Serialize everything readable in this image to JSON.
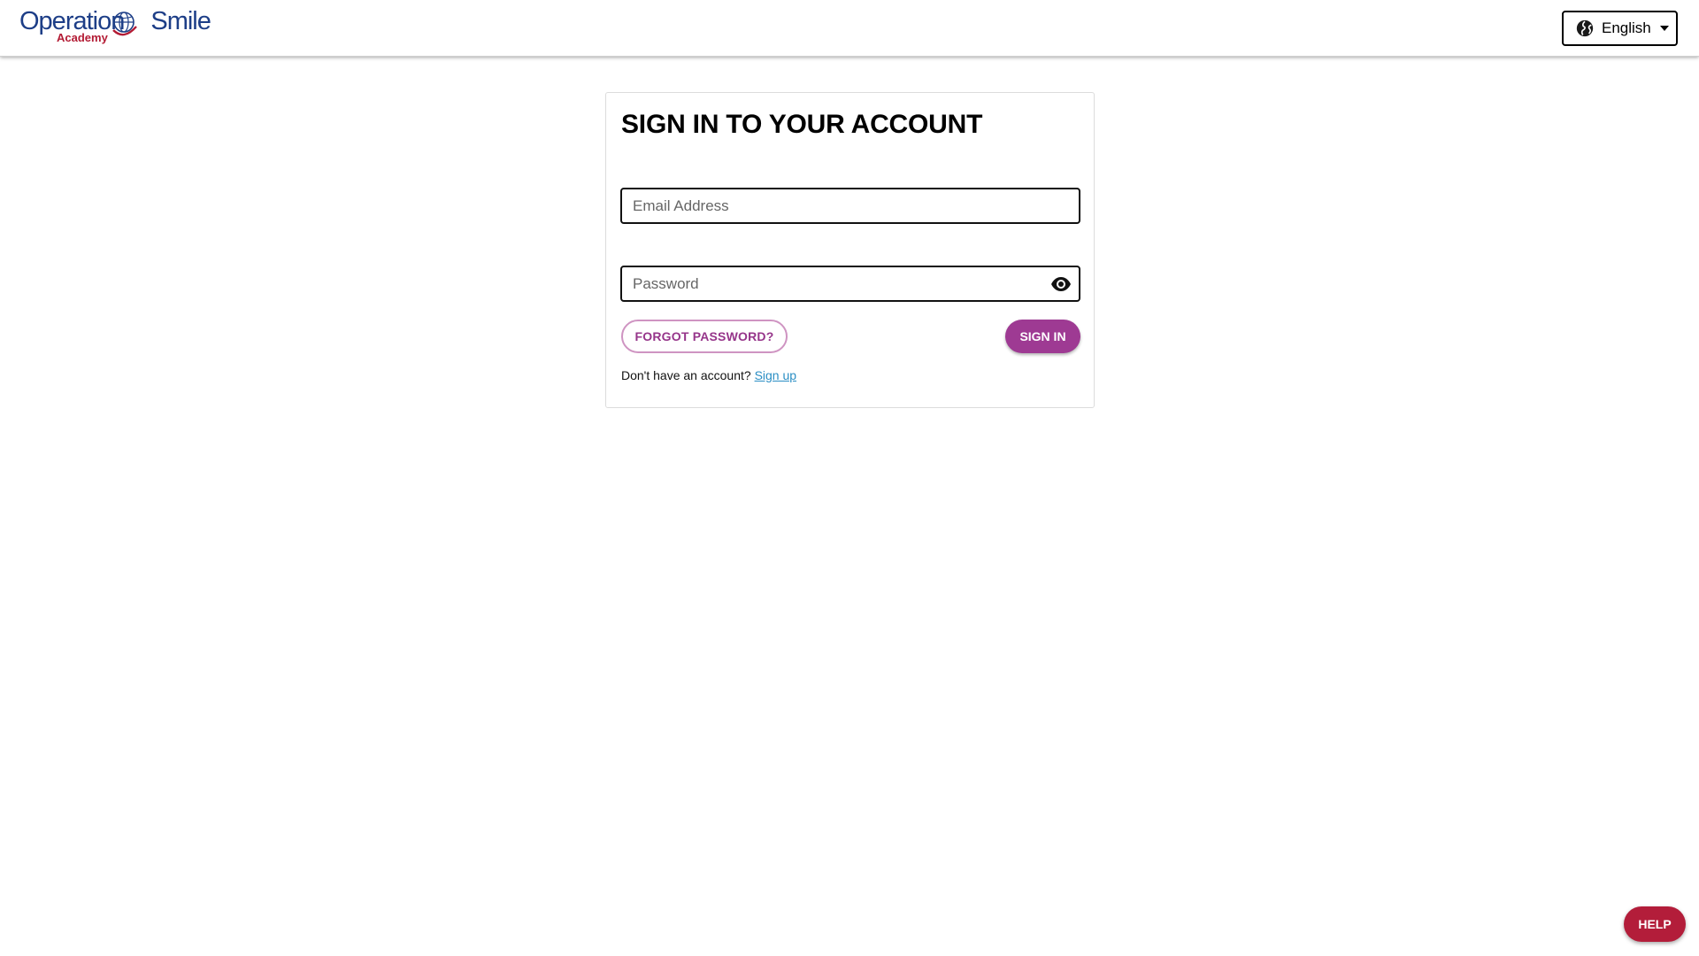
{
  "header": {
    "logo": {
      "brand_left": "Operation",
      "brand_right": "Smile",
      "sub": "Academy",
      "icon": "globe-logo-icon"
    },
    "language": {
      "selected": "English",
      "icon": "globe-icon",
      "caret_icon": "caret-down-icon"
    }
  },
  "login": {
    "title": "SIGN IN TO YOUR ACCOUNT",
    "email_placeholder": "Email Address",
    "password_placeholder": "Password",
    "eye_icon": "eye-icon",
    "forgot_label": "FORGOT PASSWORD?",
    "signin_label": "SIGN IN",
    "no_account_text": "Don't have an account?",
    "signup_link": "Sign up"
  },
  "help": {
    "label": "HELP"
  },
  "colors": {
    "brand_blue": "#1d3e87",
    "brand_red": "#b31b34",
    "primary_purple": "#9e3a93",
    "link_blue": "#2a8ec4",
    "help_red": "#b31d3a"
  }
}
